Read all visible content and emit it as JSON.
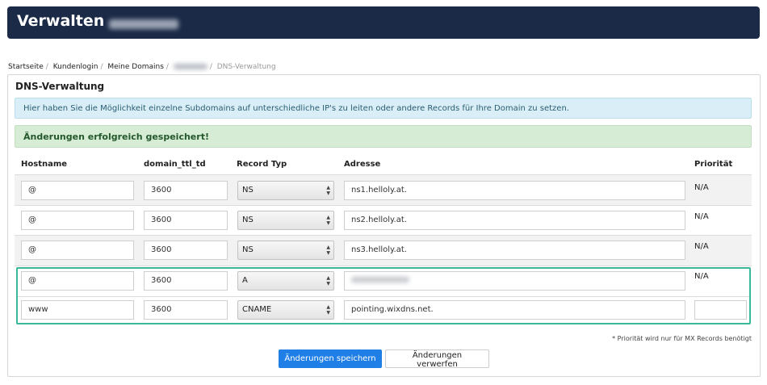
{
  "header": {
    "title": "Verwalten"
  },
  "breadcrumb": {
    "items": [
      "Startseite",
      "Kundenlogin",
      "Meine Domains"
    ],
    "current": "DNS-Verwaltung"
  },
  "panel": {
    "title": "DNS-Verwaltung",
    "info": "Hier haben Sie die Möglichkeit einzelne Subdomains auf unterschiedliche IP's zu leiten oder andere Records für Ihre Domain zu setzen.",
    "success": "Änderungen erfolgreich gespeichert!"
  },
  "table": {
    "columns": [
      "Hostname",
      "domain_ttl_td",
      "Record Typ",
      "Adresse",
      "Priorität"
    ],
    "rows": [
      {
        "hostname": "@",
        "ttl": "3600",
        "type": "NS",
        "address": "ns1.helloly.at.",
        "priority": "N/A"
      },
      {
        "hostname": "@",
        "ttl": "3600",
        "type": "NS",
        "address": "ns2.helloly.at.",
        "priority": "N/A"
      },
      {
        "hostname": "@",
        "ttl": "3600",
        "type": "NS",
        "address": "ns3.helloly.at.",
        "priority": "N/A"
      },
      {
        "hostname": "@",
        "ttl": "3600",
        "type": "A",
        "address": "",
        "priority": "N/A"
      },
      {
        "hostname": "www",
        "ttl": "3600",
        "type": "CNAME",
        "address": "pointing.wixdns.net.",
        "priority": ""
      }
    ]
  },
  "note": "* Priorität wird nur für MX Records benötigt",
  "buttons": {
    "save": "Änderungen speichern",
    "discard": "Änderungen verwerfen"
  },
  "colors": {
    "header_bg": "#1b2a47",
    "primary": "#1f7fe6",
    "highlight": "#39b89a",
    "success_bg": "#d7ecd5",
    "info_bg": "#d9eef6"
  }
}
